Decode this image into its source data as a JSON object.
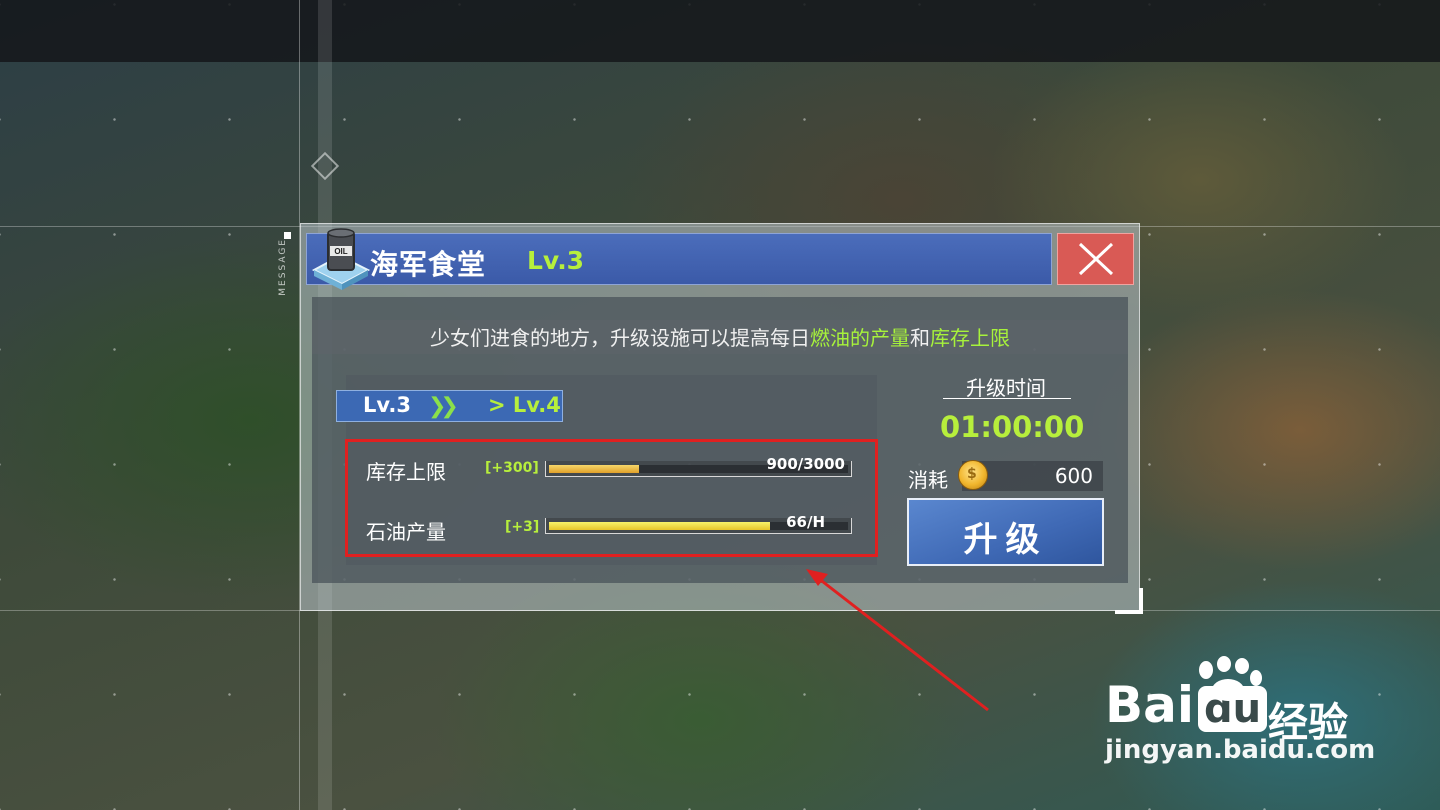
{
  "side_label": "MESSAGE",
  "building": {
    "name": "海军食堂",
    "level": "Lv.3",
    "icon_text": "OIL"
  },
  "description": {
    "prefix": "少女们进食的地方，升级设施可以提高每日",
    "highlight1": "燃油的产量",
    "mid": "和",
    "highlight2": "库存上限"
  },
  "upgrade": {
    "from_level": "Lv.3",
    "arrows": "❯❯",
    "to_level": "> Lv.4"
  },
  "stats": [
    {
      "label": "库存上限",
      "increase": "[+300]",
      "value": "900/3000",
      "fill": 0.3
    },
    {
      "label": "石油产量",
      "increase": "[+3]",
      "value": "66/H",
      "fill": 0.74
    }
  ],
  "time": {
    "label": "升级时间",
    "value": "01:00:00"
  },
  "cost": {
    "label": "消耗",
    "value": "600"
  },
  "upgrade_button": "升级",
  "watermark": {
    "logo": "Bai",
    "logo2": "du",
    "brand_cn": "经验",
    "url": "jingyan.baidu.com"
  },
  "colors": {
    "accent_green": "#b7ef3c",
    "title_blue": "#3b5aa8",
    "close_red": "#d95a55",
    "highlight_red": "#e02020"
  }
}
